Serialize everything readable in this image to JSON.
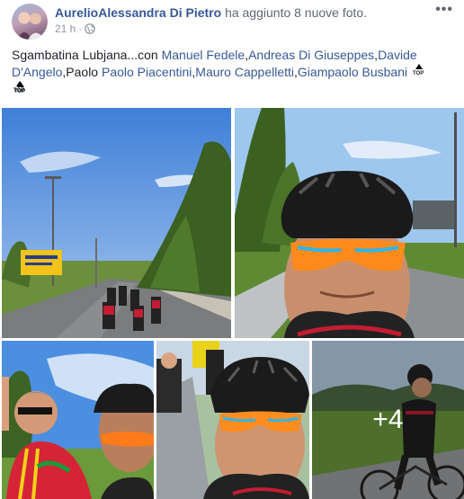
{
  "post": {
    "author": "AurelioAlessandra Di Pietro",
    "action": "ha aggiunto 8 nuove foto.",
    "timestamp": "21 h",
    "more_icon": "•••",
    "privacy_icon": "globe-icon",
    "caption_start": "Sgambatina Lubjana...con ",
    "tagged": [
      "Manuel Fedele",
      "Andreas Di Giuseppes",
      "Davide D'Angelo"
    ],
    "plain_name": "Paolo",
    "tagged_2": [
      "Paolo Piacentini",
      "Mauro Cappelletti",
      "Giampaolo Busbani"
    ],
    "emoji_label": "TOP",
    "separator": ","
  },
  "photos": {
    "more_count": "+4",
    "count": 5
  }
}
